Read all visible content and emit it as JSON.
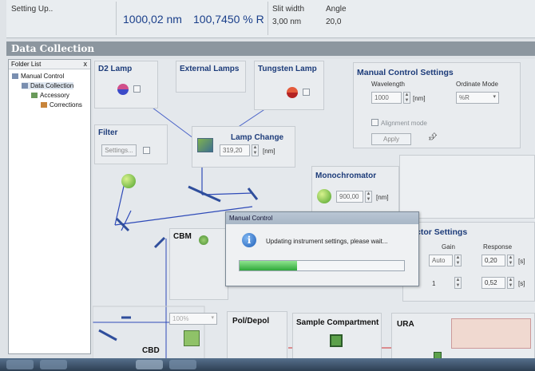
{
  "status": {
    "state": "Setting Up..",
    "wavelength": "1000,02 nm",
    "reading": "100,7450 % R",
    "slit_label": "Slit width",
    "slit_value": "3,00 nm",
    "angle_label": "Angle",
    "angle_value": "20,0"
  },
  "window": {
    "title": "Data Collection"
  },
  "tree": {
    "header": "Folder List",
    "close": "x",
    "items": [
      {
        "label": "Manual Control"
      },
      {
        "label": "Data Collection"
      },
      {
        "label": "Accessory"
      },
      {
        "label": "Corrections"
      }
    ]
  },
  "sections": {
    "d2_lamp": "D2 Lamp",
    "external_lamps": "External Lamps",
    "tungsten_lamp": "Tungsten Lamp",
    "filter": "Filter",
    "filter_settings": "Settings...",
    "lamp_change": "Lamp Change",
    "lamp_change_value": "319,20",
    "lamp_change_unit": "[nm]",
    "monochromator": "Monochromator",
    "mono_value": "900,00",
    "mono_unit": "[nm]",
    "cbm": "CBM",
    "cbd": "CBD",
    "pol_depol": "Pol/Depol",
    "sample_compartment": "Sample Compartment",
    "ura": "URA",
    "atten_value": "100%"
  },
  "manual_control": {
    "title": "Manual Control Settings",
    "wavelength_label": "Wavelength",
    "wavelength_value": "1000",
    "wavelength_unit": "[nm]",
    "ordinate_label": "Ordinate Mode",
    "ordinate_value": "%R",
    "alignment_label": "Alignment mode",
    "apply_label": "Apply"
  },
  "detector": {
    "title": "ctor Settings",
    "gain_label": "Gain",
    "response_label": "Response",
    "gain_1": "Auto",
    "gain_2": "1",
    "response_1": "0,20",
    "response_2": "0,52",
    "unit": "[s]"
  },
  "dialog": {
    "title": "Manual Control",
    "message": "Updating instrument settings, please wait...",
    "icon": "info-icon",
    "progress": 0.35
  },
  "colors": {
    "accent": "#1d3c7a",
    "title_bar": "#8c969f",
    "progress": "#2fa83a"
  }
}
